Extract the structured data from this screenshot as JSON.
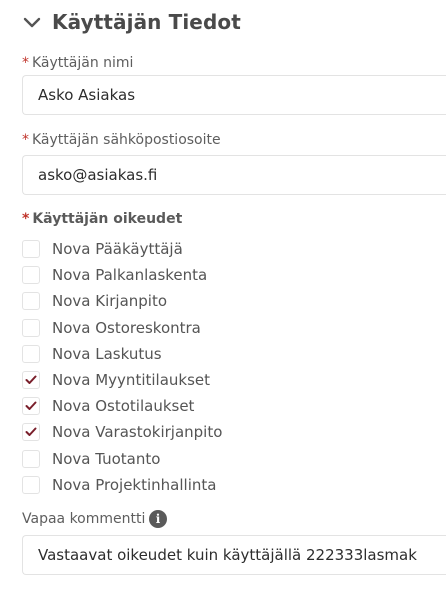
{
  "section": {
    "title": "Käyttäjän Tiedot",
    "toggle_icon": "chevron-down-icon"
  },
  "fields": {
    "name": {
      "required_mark": "*",
      "label": "Käyttäjän nimi",
      "value": "Asko Asiakas"
    },
    "email": {
      "required_mark": "*",
      "label": "Käyttäjän sähköpostiosoite",
      "value": "asko@asiakas.fi"
    },
    "permissions": {
      "required_mark": "*",
      "label": "Käyttäjän oikeudet",
      "items": [
        {
          "label": "Nova Pääkäyttäjä",
          "checked": false
        },
        {
          "label": "Nova Palkanlaskenta",
          "checked": false
        },
        {
          "label": "Nova Kirjanpito",
          "checked": false
        },
        {
          "label": "Nova Ostoreskontra",
          "checked": false
        },
        {
          "label": "Nova Laskutus",
          "checked": false
        },
        {
          "label": "Nova Myyntitilaukset",
          "checked": true
        },
        {
          "label": "Nova Ostotilaukset",
          "checked": true
        },
        {
          "label": "Nova Varastokirjanpito",
          "checked": true
        },
        {
          "label": "Nova Tuotanto",
          "checked": false
        },
        {
          "label": "Nova Projektinhallinta",
          "checked": false
        }
      ]
    },
    "comment": {
      "label": "Vapaa kommentti",
      "info_icon": "info-icon",
      "value": "Vastaavat oikeudet kuin käyttäjällä 222333lasmak"
    }
  },
  "colors": {
    "required": "#c0342b",
    "checkmark": "#7a1f2b",
    "border": "#e3e3e3"
  }
}
